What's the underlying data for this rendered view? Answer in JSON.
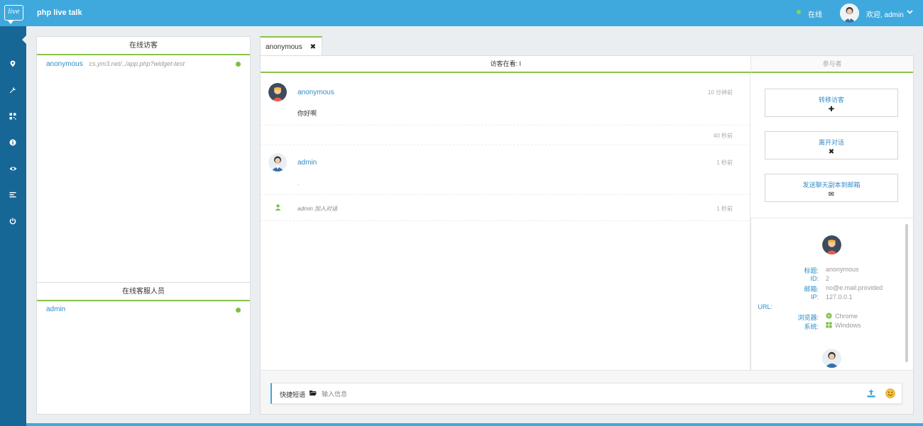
{
  "app": {
    "logo_text": "live",
    "title": "php live talk"
  },
  "header": {
    "status": "在线",
    "welcome": "欢迎, admin",
    "caret": "⌄"
  },
  "sidebar": {
    "items": [
      {
        "icon": "map-marker-icon"
      },
      {
        "icon": "wrench-icon"
      },
      {
        "icon": "qrcode-icon"
      },
      {
        "icon": "info-icon"
      },
      {
        "icon": "eye-icon"
      },
      {
        "icon": "list-icon"
      },
      {
        "icon": "power-icon"
      }
    ]
  },
  "visitors_panel": {
    "title": "在线访客",
    "visitors": [
      {
        "name": "anonymous",
        "url": "cs.ym3.net/../app.php?widget-test"
      }
    ]
  },
  "agents_panel": {
    "title": "在线客服人员",
    "agents": [
      {
        "name": "admin"
      }
    ]
  },
  "chat_tab": {
    "label": "anonymous",
    "close": "✖"
  },
  "chat": {
    "viewing_label": "访客在看: l",
    "participants_label": "参与者",
    "messages": [
      {
        "name": "anonymous",
        "time": "10 分钟前",
        "text": "你好啊"
      },
      {
        "time": "40 秒前"
      },
      {
        "name": "admin",
        "time": "1 秒前",
        "text": "."
      },
      {
        "system_text": "admin 加入对话",
        "time": "1 秒前"
      }
    ]
  },
  "actions": {
    "transfer": {
      "label": "转移访客",
      "glyph": "✚"
    },
    "leave": {
      "label": "离开对话",
      "glyph": "✖"
    },
    "email": {
      "label": "发送聊天副本到邮箱",
      "glyph": "✉"
    }
  },
  "visitor_info": {
    "title_label": "标题:",
    "title_value": "anonymous",
    "id_label": "ID:",
    "id_value": "2",
    "email_label": "邮箱:",
    "email_value": "no@e.mail.provided",
    "ip_label": "IP:",
    "ip_value": "127.0.0.1",
    "url_label": "URL:",
    "browser_label": "浏览器:",
    "browser_value": "Chrome",
    "os_label": "系统:",
    "os_value": "Windows"
  },
  "composer": {
    "quick_label": "快捷短语",
    "placeholder": "输入信息"
  },
  "colors": {
    "topbar": "#3fa9de",
    "sidebar": "#176796",
    "accent_green": "#8bc34a",
    "link_blue": "#2f8ec9"
  }
}
